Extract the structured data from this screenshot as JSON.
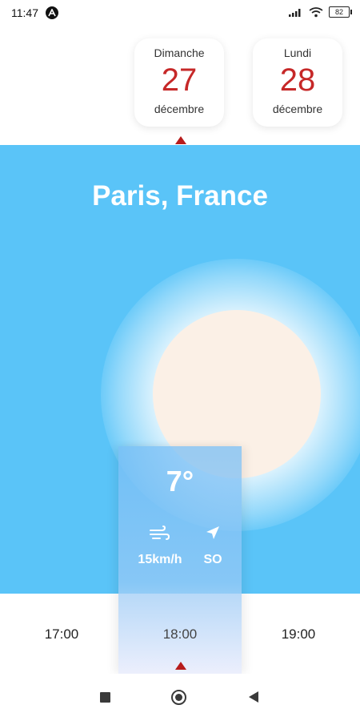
{
  "status_bar": {
    "time": "11:47",
    "battery": "82",
    "icons": [
      "a-icon",
      "signal-icon",
      "wifi-icon",
      "battery-icon"
    ]
  },
  "days": [
    {
      "weekday": "Dimanche",
      "day": "27",
      "month": "décembre",
      "selected": true
    },
    {
      "weekday": "Lundi",
      "day": "28",
      "month": "décembre",
      "selected": false
    }
  ],
  "weather": {
    "city": "Paris, France",
    "temperature": "7°",
    "wind_speed": "15km/h",
    "wind_direction": "SO",
    "icons": [
      "wind-icon",
      "direction-icon"
    ]
  },
  "hours": [
    {
      "label": "17:00",
      "selected": false
    },
    {
      "label": "18:00",
      "selected": true
    },
    {
      "label": "19:00",
      "selected": false
    }
  ],
  "colors": {
    "sky": "#5ac4f8",
    "sun": "#fbf0e6",
    "accent_red": "#c62828"
  }
}
